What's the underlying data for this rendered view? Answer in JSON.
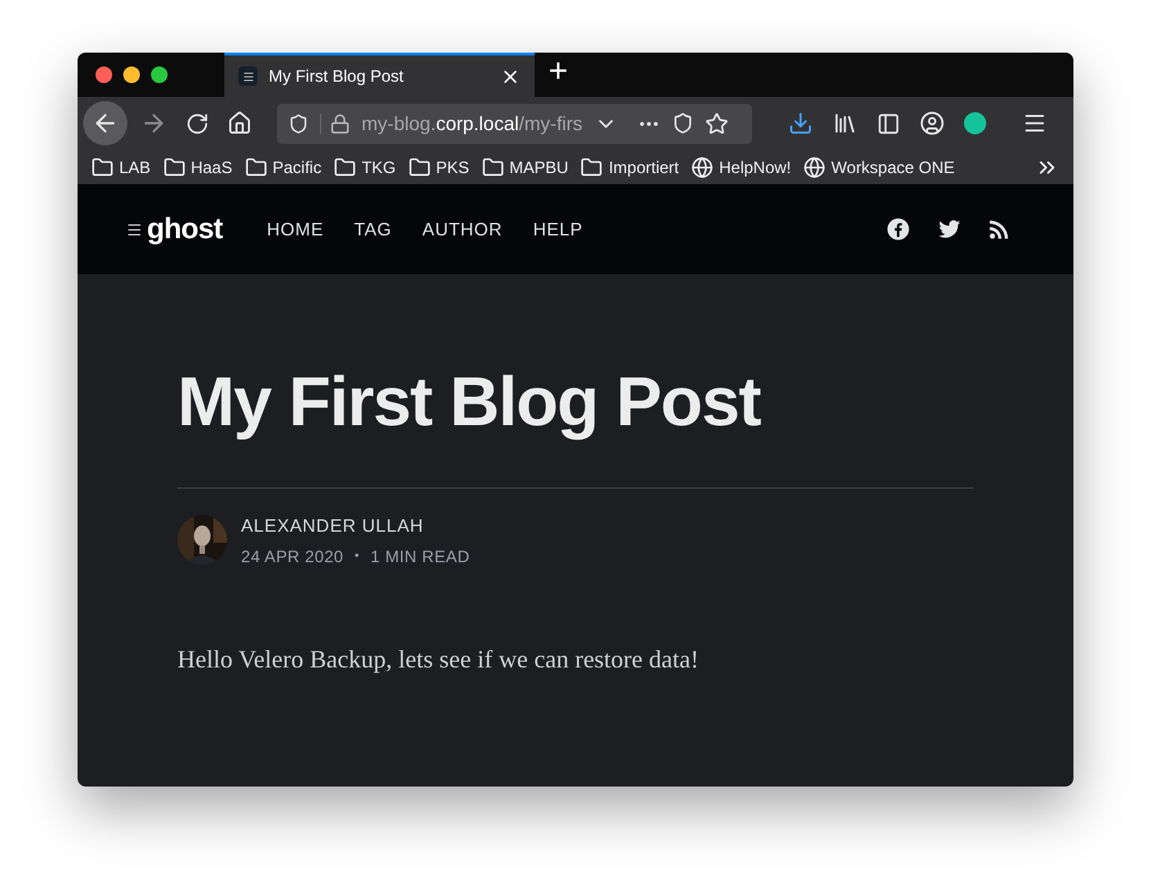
{
  "browser": {
    "tab": {
      "title": "My First Blog Post",
      "selected": true
    },
    "new_tab": "+",
    "url": "my-blog.**corp.local**/my-firs",
    "bookmarks": [
      {
        "kind": "folder",
        "label": "LAB"
      },
      {
        "kind": "folder",
        "label": "HaaS"
      },
      {
        "kind": "folder",
        "label": "Pacific"
      },
      {
        "kind": "folder",
        "label": "TKG"
      },
      {
        "kind": "folder",
        "label": "PKS"
      },
      {
        "kind": "folder",
        "label": "MAPBU"
      },
      {
        "kind": "folder",
        "label": "Importiert"
      },
      {
        "kind": "web",
        "label": "HelpNow!"
      },
      {
        "kind": "web",
        "label": "Workspace ONE"
      }
    ]
  },
  "site": {
    "logo": "ghost",
    "nav": [
      "HOME",
      "TAG",
      "AUTHOR",
      "HELP"
    ]
  },
  "post": {
    "title": "My First Blog Post",
    "author": "ALEXANDER ULLAH",
    "date": "24 APR 2020",
    "separator": "•",
    "reading_time": "1 MIN READ",
    "body": "Hello Velero Backup, lets see if we can restore data!"
  }
}
